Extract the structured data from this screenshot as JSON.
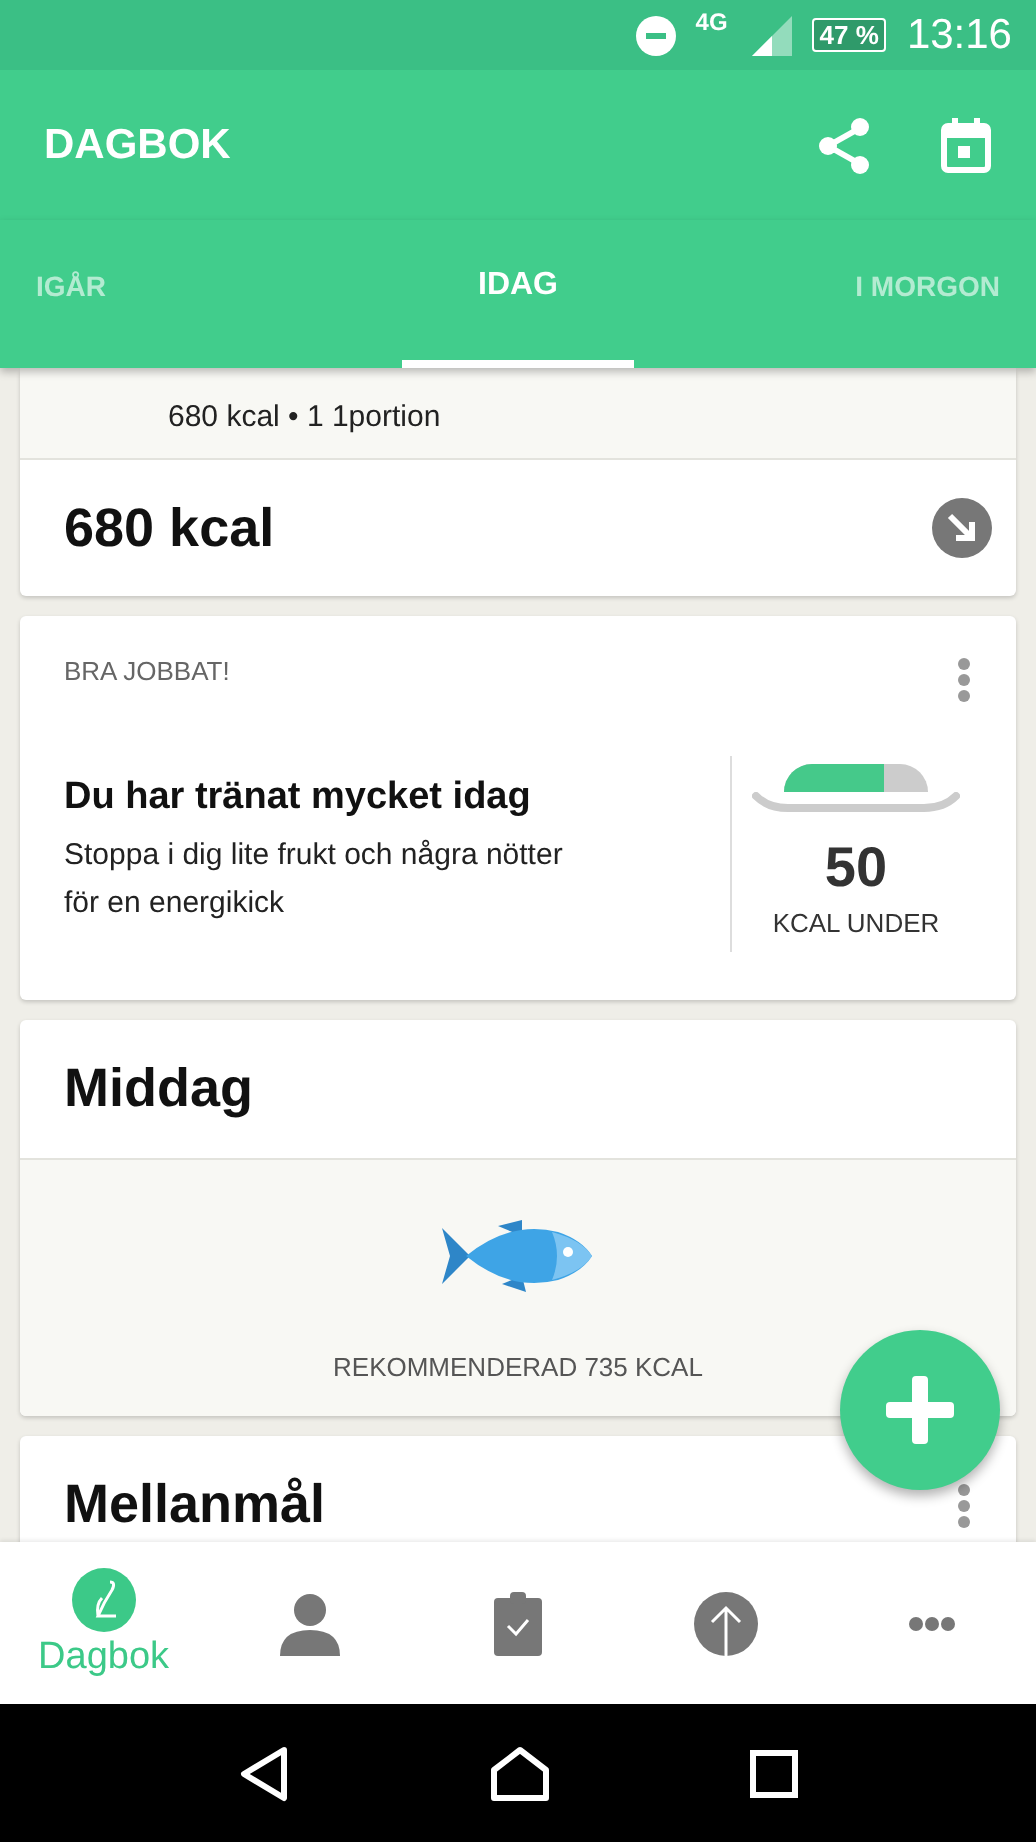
{
  "status_bar": {
    "network": "4G",
    "battery": "47 %",
    "time": "13:16"
  },
  "app_bar": {
    "title": "DAGBOK"
  },
  "tabs": [
    {
      "label": "IGÅR",
      "selected": false
    },
    {
      "label": "IDAG",
      "selected": true
    },
    {
      "label": "I MORGON",
      "selected": false
    }
  ],
  "entry_card": {
    "detail": "680 kcal • 1 1portion",
    "total": "680 kcal"
  },
  "tip_card": {
    "label": "BRA JOBBAT!",
    "title": "Du har tränat mycket idag",
    "text": "Stoppa i dig lite frukt och några nötter för en energikick",
    "gauge": {
      "level": 0.7
    },
    "value": "50",
    "unit": "KCAL UNDER"
  },
  "meals": [
    {
      "title": "Middag",
      "recommended": "REKOMMENDERAD 735 KCAL",
      "menu": false
    },
    {
      "title": "Mellanmål",
      "menu": true
    }
  ],
  "bottom_nav": [
    {
      "kind": "diary",
      "label": "Dagbok",
      "selected": true
    },
    {
      "kind": "profile",
      "selected": false
    },
    {
      "kind": "plan",
      "selected": false
    },
    {
      "kind": "progress",
      "selected": false
    },
    {
      "kind": "more",
      "selected": false
    }
  ]
}
